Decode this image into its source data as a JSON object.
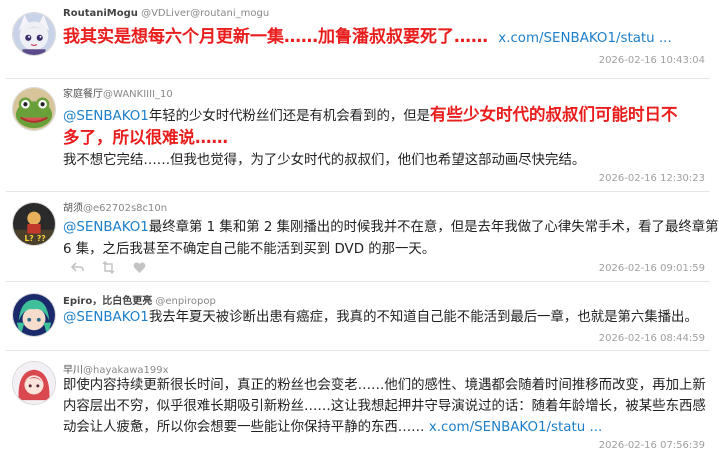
{
  "tweets": [
    {
      "author": {
        "display_name": "RoutaniMogu",
        "handle": "@VDLiver@routani_mogu"
      },
      "avatar_icon": "anime-girl-avatar-icon",
      "body": {
        "highlight": "我其实是想每六个月更新一集……加鲁潘叔叔要死了……",
        "link": "x.com/SENBAKO1/statu ..."
      },
      "timestamp": "2026-02-16 10:43:04"
    },
    {
      "author": {
        "display_name": "家庭餐厅",
        "handle": "@WANKIIII_10"
      },
      "avatar_icon": "green-frog-avatar-icon",
      "body": {
        "mention": "@SENBAKO1",
        "line1_text": "年轻的少女时代粉丝们还是有机会看到的，但是",
        "line1_highlight": "有些少女时代的叔叔们可能时日不",
        "line2_highlight": "多了，所以很难说……",
        "line3_text": "我不想它完结……但我也觉得，为了少女时代的叔叔们，他们也希望这部动画尽快完结。"
      },
      "timestamp": "2026-02-16 12:30:23"
    },
    {
      "author": {
        "display_name": "胡须",
        "handle": "@e62702s8c10n"
      },
      "avatar_icon": "game-character-avatar-icon",
      "body": {
        "mention": "@SENBAKO1",
        "line1_text": "最终章第 1 集和第 2 集刚播出的时候我并不在意，但是去年我做了心律失常手术，看了最终章第",
        "line2_text": "6 集，之后我甚至不确定自己能不能活到买到 DVD 的那一天。"
      },
      "timestamp": "2026-02-16 09:01:59"
    },
    {
      "author": {
        "display_name": "Epiro，比白色更亮",
        "handle": "@enpiropop"
      },
      "avatar_icon": "green-hair-anime-avatar-icon",
      "body": {
        "mention": "@SENBAKO1",
        "line1_text": "我去年夏天被诊断出患有癌症，我真的不知道自己能不能活到最后一章，也就是第六集播出。"
      },
      "timestamp": "2026-02-16 08:44:59"
    },
    {
      "author": {
        "display_name": "早川",
        "handle": "@hayakawa199x"
      },
      "avatar_icon": "red-hair-anime-avatar-icon",
      "body": {
        "line1_text": "即使内容持续更新很长时间，真正的粉丝也会变老……他们的感性、境遇都会随着时间推移而改变，再加上新",
        "line2_text": "内容层出不穷，似乎很难长期吸引新粉丝……这让我想起押井守导演说过的话：随着年龄增长，被某些东西感",
        "line3_text": "动会让人疲惫，所以你会想要一些能让你保持平静的东西……",
        "link": "x.com/SENBAKO1/statu ..."
      },
      "timestamp": "2026-02-16 07:56:39"
    }
  ],
  "action_icons": [
    "reply-icon",
    "retweet-icon",
    "like-icon"
  ]
}
